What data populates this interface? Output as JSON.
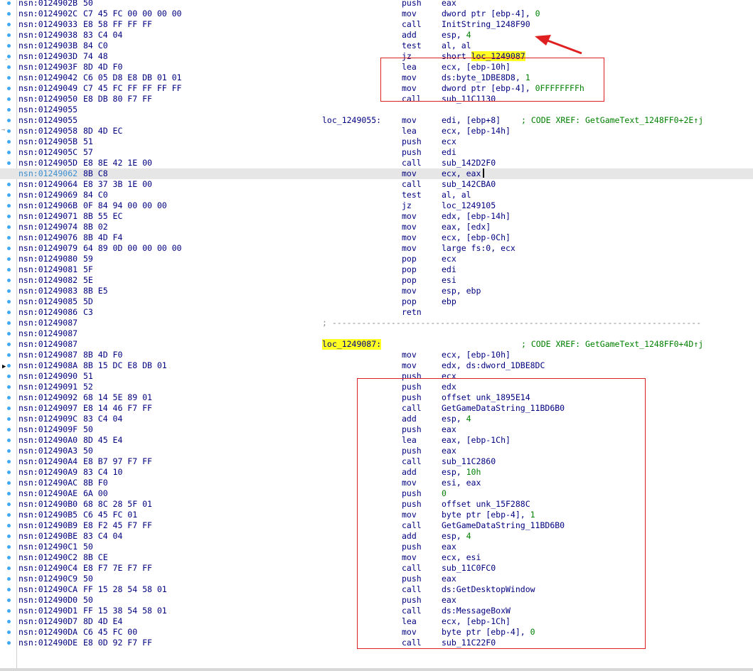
{
  "rows": [
    {
      "addr": "nsn:0124902B",
      "bytes": "50",
      "mnem": "push",
      "ops": "eax"
    },
    {
      "addr": "nsn:0124902C",
      "bytes": "C7 45 FC 00 00 00 00",
      "mnem": "mov",
      "ops": "dword ptr [ebp-4], ",
      "num": "0"
    },
    {
      "addr": "nsn:01249033",
      "bytes": "E8 58 FF FF FF",
      "mnem": "call",
      "ops": "InitString_1248F90"
    },
    {
      "addr": "nsn:01249038",
      "bytes": "83 C4 04",
      "mnem": "add",
      "ops": "esp, ",
      "num": "4"
    },
    {
      "addr": "nsn:0124903B",
      "bytes": "84 C0",
      "mnem": "test",
      "ops": "al, al"
    },
    {
      "addr": "nsn:0124903D",
      "bytes": "74 48",
      "mnem": "jz",
      "ops": "short ",
      "yl": "loc_1249087"
    },
    {
      "addr": "nsn:0124903F",
      "bytes": "8D 4D F0",
      "mnem": "lea",
      "ops": "ecx, [ebp-10h]"
    },
    {
      "addr": "nsn:01249042",
      "bytes": "C6 05 D8 E8 DB 01 01",
      "mnem": "mov",
      "ops": "ds:byte_1DBE8D8, ",
      "num": "1"
    },
    {
      "addr": "nsn:01249049",
      "bytes": "C7 45 FC FF FF FF FF",
      "mnem": "mov",
      "ops": "dword ptr [ebp-4], ",
      "num": "0FFFFFFFFh"
    },
    {
      "addr": "nsn:01249050",
      "bytes": "E8 DB 80 F7 FF",
      "mnem": "call",
      "ops": "sub_11C1130"
    },
    {
      "addr": "nsn:01249055"
    },
    {
      "addr": "nsn:01249055",
      "label": "loc_1249055:",
      "mnem": "mov",
      "ops": "edi, [ebp+8]",
      "xref": "; CODE XREF: GetGameText_1248FF0+2E↑j"
    },
    {
      "addr": "nsn:01249058",
      "bytes": "8D 4D EC",
      "mnem": "lea",
      "ops": "ecx, [ebp-14h]"
    },
    {
      "addr": "nsn:0124905B",
      "bytes": "51",
      "mnem": "push",
      "ops": "ecx"
    },
    {
      "addr": "nsn:0124905C",
      "bytes": "57",
      "mnem": "push",
      "ops": "edi"
    },
    {
      "addr": "nsn:0124905D",
      "bytes": "E8 8E 42 1E 00",
      "mnem": "call",
      "ops": "sub_142D2F0"
    },
    {
      "addr": "nsn:01249062",
      "bytes": "8B C8",
      "mnem": "mov",
      "ops": "ecx, eax",
      "hl": true
    },
    {
      "addr": "nsn:01249064",
      "bytes": "E8 37 3B 1E 00",
      "mnem": "call",
      "ops": "sub_142CBA0"
    },
    {
      "addr": "nsn:01249069",
      "bytes": "84 C0",
      "mnem": "test",
      "ops": "al, al"
    },
    {
      "addr": "nsn:0124906B",
      "bytes": "0F 84 94 00 00 00",
      "mnem": "jz",
      "ops": "loc_1249105"
    },
    {
      "addr": "nsn:01249071",
      "bytes": "8B 55 EC",
      "mnem": "mov",
      "ops": "edx, [ebp-14h]"
    },
    {
      "addr": "nsn:01249074",
      "bytes": "8B 02",
      "mnem": "mov",
      "ops": "eax, [edx]"
    },
    {
      "addr": "nsn:01249076",
      "bytes": "8B 4D F4",
      "mnem": "mov",
      "ops": "ecx, [ebp-0Ch]"
    },
    {
      "addr": "nsn:01249079",
      "bytes": "64 89 0D 00 00 00 00",
      "mnem": "mov",
      "ops": "large fs:0, ecx"
    },
    {
      "addr": "nsn:01249080",
      "bytes": "59",
      "mnem": "pop",
      "ops": "ecx"
    },
    {
      "addr": "nsn:01249081",
      "bytes": "5F",
      "mnem": "pop",
      "ops": "edi"
    },
    {
      "addr": "nsn:01249082",
      "bytes": "5E",
      "mnem": "pop",
      "ops": "esi"
    },
    {
      "addr": "nsn:01249083",
      "bytes": "8B E5",
      "mnem": "mov",
      "ops": "esp, ebp"
    },
    {
      "addr": "nsn:01249085",
      "bytes": "5D",
      "mnem": "pop",
      "ops": "ebp"
    },
    {
      "addr": "nsn:01249086",
      "bytes": "C3",
      "mnem": "retn"
    },
    {
      "addr": "nsn:01249087",
      "sep": "; ---------------------------------------------------------------------------"
    },
    {
      "addr": "nsn:01249087"
    },
    {
      "addr": "nsn:01249087",
      "label": "loc_1249087:",
      "labelYl": true,
      "xref": "; CODE XREF: GetGameText_1248FF0+4D↑j"
    },
    {
      "addr": "nsn:01249087",
      "bytes": "8B 4D F0",
      "mnem": "mov",
      "ops": "ecx, [ebp-10h]"
    },
    {
      "addr": "nsn:0124908A",
      "bytes": "8B 15 DC E8 DB 01",
      "mnem": "mov",
      "ops": "edx, ds:dword_1DBE8DC"
    },
    {
      "addr": "nsn:01249090",
      "bytes": "51",
      "mnem": "push",
      "ops": "ecx"
    },
    {
      "addr": "nsn:01249091",
      "bytes": "52",
      "mnem": "push",
      "ops": "edx"
    },
    {
      "addr": "nsn:01249092",
      "bytes": "68 14 5E 89 01",
      "mnem": "push",
      "ops": "offset unk_1895E14"
    },
    {
      "addr": "nsn:01249097",
      "bytes": "E8 14 46 F7 FF",
      "mnem": "call",
      "ops": "GetGameDataString_11BD6B0"
    },
    {
      "addr": "nsn:0124909C",
      "bytes": "83 C4 04",
      "mnem": "add",
      "ops": "esp, ",
      "num": "4"
    },
    {
      "addr": "nsn:0124909F",
      "bytes": "50",
      "mnem": "push",
      "ops": "eax"
    },
    {
      "addr": "nsn:012490A0",
      "bytes": "8D 45 E4",
      "mnem": "lea",
      "ops": "eax, [ebp-1Ch]"
    },
    {
      "addr": "nsn:012490A3",
      "bytes": "50",
      "mnem": "push",
      "ops": "eax"
    },
    {
      "addr": "nsn:012490A4",
      "bytes": "E8 B7 97 F7 FF",
      "mnem": "call",
      "ops": "sub_11C2860"
    },
    {
      "addr": "nsn:012490A9",
      "bytes": "83 C4 10",
      "mnem": "add",
      "ops": "esp, ",
      "num": "10h"
    },
    {
      "addr": "nsn:012490AC",
      "bytes": "8B F0",
      "mnem": "mov",
      "ops": "esi, eax"
    },
    {
      "addr": "nsn:012490AE",
      "bytes": "6A 00",
      "mnem": "push",
      "ops": "",
      "num": "0"
    },
    {
      "addr": "nsn:012490B0",
      "bytes": "68 8C 28 5F 01",
      "mnem": "push",
      "ops": "offset unk_15F288C"
    },
    {
      "addr": "nsn:012490B5",
      "bytes": "C6 45 FC 01",
      "mnem": "mov",
      "ops": "byte ptr [ebp-4], ",
      "num": "1"
    },
    {
      "addr": "nsn:012490B9",
      "bytes": "E8 F2 45 F7 FF",
      "mnem": "call",
      "ops": "GetGameDataString_11BD6B0"
    },
    {
      "addr": "nsn:012490BE",
      "bytes": "83 C4 04",
      "mnem": "add",
      "ops": "esp, ",
      "num": "4"
    },
    {
      "addr": "nsn:012490C1",
      "bytes": "50",
      "mnem": "push",
      "ops": "eax"
    },
    {
      "addr": "nsn:012490C2",
      "bytes": "8B CE",
      "mnem": "mov",
      "ops": "ecx, esi"
    },
    {
      "addr": "nsn:012490C4",
      "bytes": "E8 F7 7E F7 FF",
      "mnem": "call",
      "ops": "sub_11C0FC0"
    },
    {
      "addr": "nsn:012490C9",
      "bytes": "50",
      "mnem": "push",
      "ops": "eax"
    },
    {
      "addr": "nsn:012490CA",
      "bytes": "FF 15 28 54 58 01",
      "mnem": "call",
      "ops": "ds:GetDesktopWindow"
    },
    {
      "addr": "nsn:012490D0",
      "bytes": "50",
      "mnem": "push",
      "ops": "eax"
    },
    {
      "addr": "nsn:012490D1",
      "bytes": "FF 15 38 54 58 01",
      "mnem": "call",
      "ops": "ds:MessageBoxW"
    },
    {
      "addr": "nsn:012490D7",
      "bytes": "8D 4D E4",
      "mnem": "lea",
      "ops": "ecx, [ebp-1Ch]"
    },
    {
      "addr": "nsn:012490DA",
      "bytes": "C6 45 FC 00",
      "mnem": "mov",
      "ops": "byte ptr [ebp-4], ",
      "num": "0"
    },
    {
      "addr": "nsn:012490DE",
      "bytes": "E8 0D 92 F7 FF",
      "mnem": "call",
      "ops": "sub_11C22F0"
    }
  ],
  "colors": {
    "text": "#000080",
    "number": "#008000",
    "highlight": "#ffff22",
    "annotation": "#e02020",
    "gutter_dot": "#3fa9f5"
  }
}
